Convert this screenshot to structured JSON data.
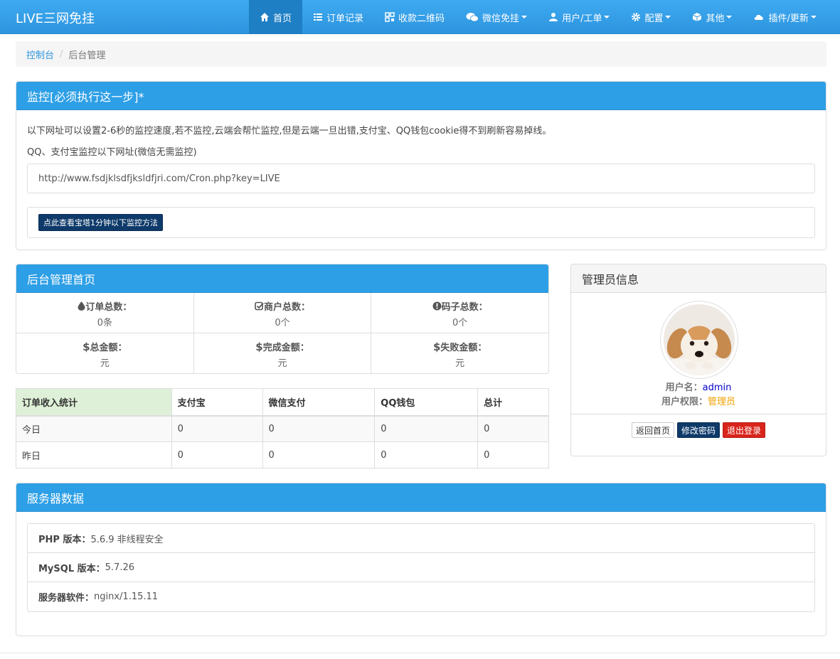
{
  "app": {
    "brand": "LIVE三网免挂"
  },
  "nav": [
    {
      "label": "首页",
      "icon": "home-icon",
      "active": true,
      "dropdown": false
    },
    {
      "label": "订单记录",
      "icon": "list-icon",
      "active": false,
      "dropdown": false
    },
    {
      "label": "收款二维码",
      "icon": "qrcode-icon",
      "active": false,
      "dropdown": false
    },
    {
      "label": "微信免挂",
      "icon": "wechat-icon",
      "active": false,
      "dropdown": true
    },
    {
      "label": "用户/工单",
      "icon": "user-icon",
      "active": false,
      "dropdown": true
    },
    {
      "label": "配置",
      "icon": "gear-icon",
      "active": false,
      "dropdown": true
    },
    {
      "label": "其他",
      "icon": "cube-icon",
      "active": false,
      "dropdown": true
    },
    {
      "label": "插件/更新",
      "icon": "cloud-icon",
      "active": false,
      "dropdown": true
    }
  ],
  "breadcrumb": {
    "root": "控制台",
    "current": "后台管理"
  },
  "monitor": {
    "title": "监控[必须执行这一步]*",
    "desc": "以下网址可以设置2-6秒的监控速度,若不监控,云端会帮忙监控,但是云端一旦出错,支付宝、QQ钱包cookie得不到刷新容易掉线。",
    "hint": "QQ、支付宝监控以下网址(微信无需监控)",
    "url": "http://www.fsdjklsdfjksldfjri.com/Cron.php?key=LIVE",
    "button": "点此查看宝塔1分钟以下监控方法"
  },
  "dashboard": {
    "title": "后台管理首页",
    "stats": [
      {
        "label": "订单总数：",
        "value": "0条",
        "icon": "drop-icon"
      },
      {
        "label": "商户总数：",
        "value": "0个",
        "icon": "check-square-icon"
      },
      {
        "label": "码子总数：",
        "value": "0个",
        "icon": "info-circle-icon"
      },
      {
        "label": "总金额：",
        "value": "元",
        "icon": "dollar-icon"
      },
      {
        "label": "完成金额：",
        "value": "元",
        "icon": "dollar-icon"
      },
      {
        "label": "失败金额：",
        "value": "元",
        "icon": "dollar-icon"
      }
    ]
  },
  "income": {
    "headers": [
      "订单收入统计",
      "支付宝",
      "微信支付",
      "QQ钱包",
      "总计"
    ],
    "rows": [
      [
        "今日",
        "0",
        "0",
        "0",
        "0"
      ],
      [
        "昨日",
        "0",
        "0",
        "0",
        "0"
      ]
    ]
  },
  "admin": {
    "title": "管理员信息",
    "username_label": "用户名：",
    "username": "admin",
    "role_label": "用户权限：",
    "role": "管理员",
    "btn_home": "返回首页",
    "btn_password": "修改密码",
    "btn_logout": "退出登录"
  },
  "server": {
    "title": "服务器数据",
    "items": [
      {
        "label": "PHP 版本：",
        "value": "5.6.9 非线程安全"
      },
      {
        "label": "MySQL 版本：",
        "value": "5.7.26"
      },
      {
        "label": "服务器软件：",
        "value": "nginx/1.15.11"
      }
    ]
  }
}
